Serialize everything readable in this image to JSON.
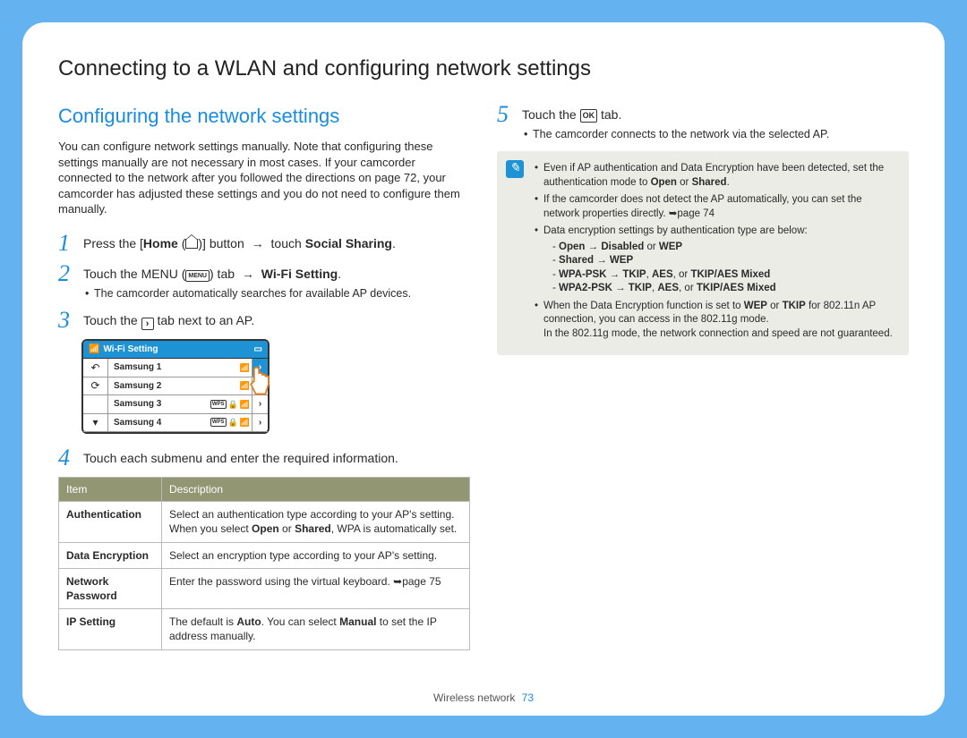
{
  "title": "Connecting to a WLAN and configuring network settings",
  "section_title": "Configuring the network settings",
  "intro": "You can configure network settings manually. Note that configuring these settings manually are not necessary in most cases. If your camcorder connected to the network after you followed the directions on page 72, your camcorder has adjusted these settings and you do not need to configure them manually.",
  "steps": {
    "s1_a": "Press the [",
    "s1_home": "Home",
    "s1_b": " (",
    "s1_c": ")] button ",
    "s1_d": " touch ",
    "s1_e": "Social Sharing",
    "s1_f": ".",
    "s2_a": "Touch the MENU (",
    "s2_menu": "MENU",
    "s2_b": ") tab ",
    "s2_c": "Wi-Fi Setting",
    "s2_d": ".",
    "s2_bullet": "The camcorder automatically searches for available AP devices.",
    "s3_a": "Touch the ",
    "s3_b": " tab next to an AP.",
    "s4": "Touch each submenu and enter the required information.",
    "s5_a": "Touch the ",
    "s5_ok": "OK",
    "s5_b": " tab.",
    "s5_bullet": "The camcorder connects to the network via the selected AP."
  },
  "wifi_screen": {
    "title": "Wi-Fi Setting",
    "rows": [
      {
        "name": "Samsung 1",
        "wps": false,
        "lock": false,
        "hi": true
      },
      {
        "name": "Samsung 2",
        "wps": false,
        "lock": false,
        "hi": false
      },
      {
        "name": "Samsung 3",
        "wps": true,
        "lock": true,
        "hi": false
      },
      {
        "name": "Samsung 4",
        "wps": true,
        "lock": true,
        "hi": false
      }
    ]
  },
  "table": {
    "headers": [
      "Item",
      "Description"
    ],
    "rows": [
      {
        "item": "Authentication",
        "desc_a": "Select an authentication type according to your AP's setting.",
        "desc_b": "When you select ",
        "desc_open": "Open",
        "desc_or": " or ",
        "desc_shared": "Shared",
        "desc_c": ", WPA is automatically set."
      },
      {
        "item": "Data Encryption",
        "desc_a": "Select an encryption type according to your AP's setting."
      },
      {
        "item": "Network Password",
        "desc_a": "Enter the password using the virtual keyboard. ",
        "page_ref": "page 75"
      },
      {
        "item": "IP Setting",
        "desc_a": "The default is ",
        "auto": "Auto",
        "desc_b": ". You can select ",
        "manual": "Manual",
        "desc_c": " to set the IP address manually."
      }
    ]
  },
  "note": {
    "n1_a": "Even if AP authentication and Data Encryption have been detected, set the authentication mode to ",
    "n1_open": "Open",
    "n1_or": " or ",
    "n1_shared": "Shared",
    "n1_b": ".",
    "n2": "If the camcorder does not detect the AP automatically, you can set the network properties directly. ",
    "n2_ref": "page 74",
    "n3": "Data encryption settings by authentication type are below:",
    "sub": [
      {
        "a": "Open",
        "arr": " → ",
        "b": "Disabled",
        "or": " or ",
        "c": "WEP"
      },
      {
        "a": "Shared",
        "arr": " → ",
        "b": "WEP"
      },
      {
        "a": "WPA-PSK",
        "arr": " → ",
        "b": "TKIP",
        "c": "AES",
        "d": "TKIP/AES Mixed"
      },
      {
        "a": "WPA2-PSK",
        "arr": " → ",
        "b": "TKIP",
        "c": "AES",
        "d": "TKIP/AES Mixed"
      }
    ],
    "n4_a": "When the Data Encryption function is set to ",
    "n4_wep": "WEP",
    "n4_or": " or ",
    "n4_tkip": "TKIP",
    "n4_b": " for 802.11n AP connection, you can access in the 802.11g mode.",
    "n4_c": "In the 802.11g mode, the network connection and speed are not guaranteed."
  },
  "footer": {
    "label": "Wireless network",
    "page": "73"
  }
}
